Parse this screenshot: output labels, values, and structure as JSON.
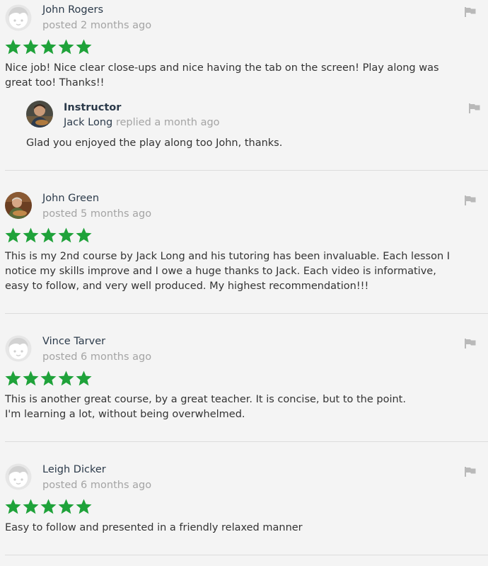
{
  "reviews": [
    {
      "name": "John Rogers",
      "posted": "posted 2 months ago",
      "rating": 5,
      "text": "Nice job! Nice clear close-ups and nice having the tab on the screen! Play along was great too! Thanks!!",
      "avatar": "default-avatar-icon",
      "reply": {
        "role": "Instructor",
        "name": "Jack Long",
        "meta": "replied a month ago",
        "text": "Glad you enjoyed the play along too John, thanks."
      }
    },
    {
      "name": "John Green",
      "posted": "posted 5 months ago",
      "rating": 5,
      "text": "This is my 2nd course by Jack Long and his tutoring has been invaluable. Each lesson I notice my skills improve and I owe a huge thanks to Jack. Each video is informative, easy to follow, and very well produced. My highest recommendation!!!",
      "avatar": "photo-avatar"
    },
    {
      "name": "Vince Tarver",
      "posted": "posted 6 months ago",
      "rating": 5,
      "text": "This is another great course, by a great teacher. It is concise, but to the point. I'm learning a lot, without being overwhelmed.",
      "avatar": "default-avatar-icon"
    },
    {
      "name": "Leigh Dicker",
      "posted": "posted 6 months ago",
      "rating": 5,
      "text": "Easy to follow and presented in a friendly relaxed manner",
      "avatar": "default-avatar-icon"
    }
  ],
  "colors": {
    "star": "#1fa23a",
    "name": "#2b3a4a",
    "muted": "#a4a4a4",
    "flag": "#b9b9b9",
    "background": "#f4f4f4"
  }
}
